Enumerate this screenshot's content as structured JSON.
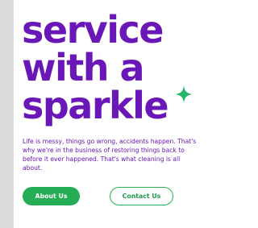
{
  "hero": {
    "headline": {
      "line1": "service",
      "line2": "with a",
      "line3": "sparkle"
    },
    "tagline": "Life is messy, things go wrong, accidents happen. That's why we're in the business of restoring things back to before it ever happened. That's what cleaning is all about.",
    "sparkle_icon": "four-point-star-icon"
  },
  "buttons": {
    "about_label": "About Us",
    "contact_label": "Contact Us"
  },
  "colors": {
    "brand_purple": "#6a17b8",
    "accent_green": "#25ad55",
    "scrollbar_gray": "#dcdcdc"
  }
}
